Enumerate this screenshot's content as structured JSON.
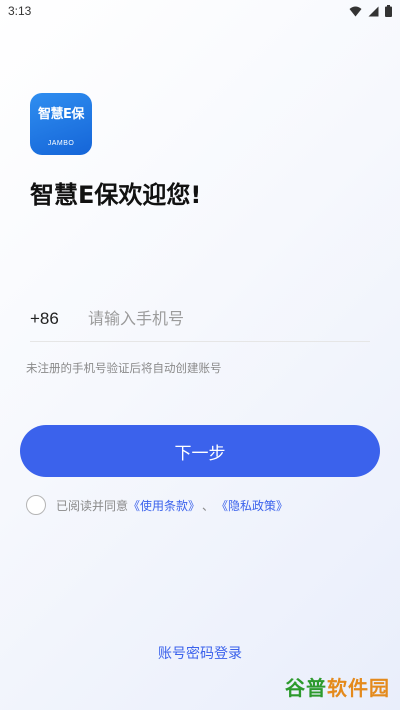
{
  "status_bar": {
    "time": "3:13",
    "wifi_icon": "wifi-icon",
    "signal_icon": "signal-icon",
    "battery_icon": "battery-icon"
  },
  "app": {
    "logo_text": "智慧E保",
    "logo_brand": "JAMBO"
  },
  "welcome": {
    "title": "智慧E保欢迎您!"
  },
  "phone": {
    "country_code": "+86",
    "placeholder": "请输入手机号",
    "value": ""
  },
  "hint": "未注册的手机号验证后将自动创建账号",
  "next_button": "下一步",
  "agreement": {
    "checked": false,
    "prefix": "已阅读并同意",
    "terms_link": "《使用条款》",
    "separator": "、",
    "privacy_link": "《隐私政策》"
  },
  "password_login": "账号密码登录",
  "watermark": {
    "part1": "谷普",
    "part2": "软件园"
  },
  "colors": {
    "accent": "#3b62ec",
    "logo_blue": "#1f7ae6"
  }
}
